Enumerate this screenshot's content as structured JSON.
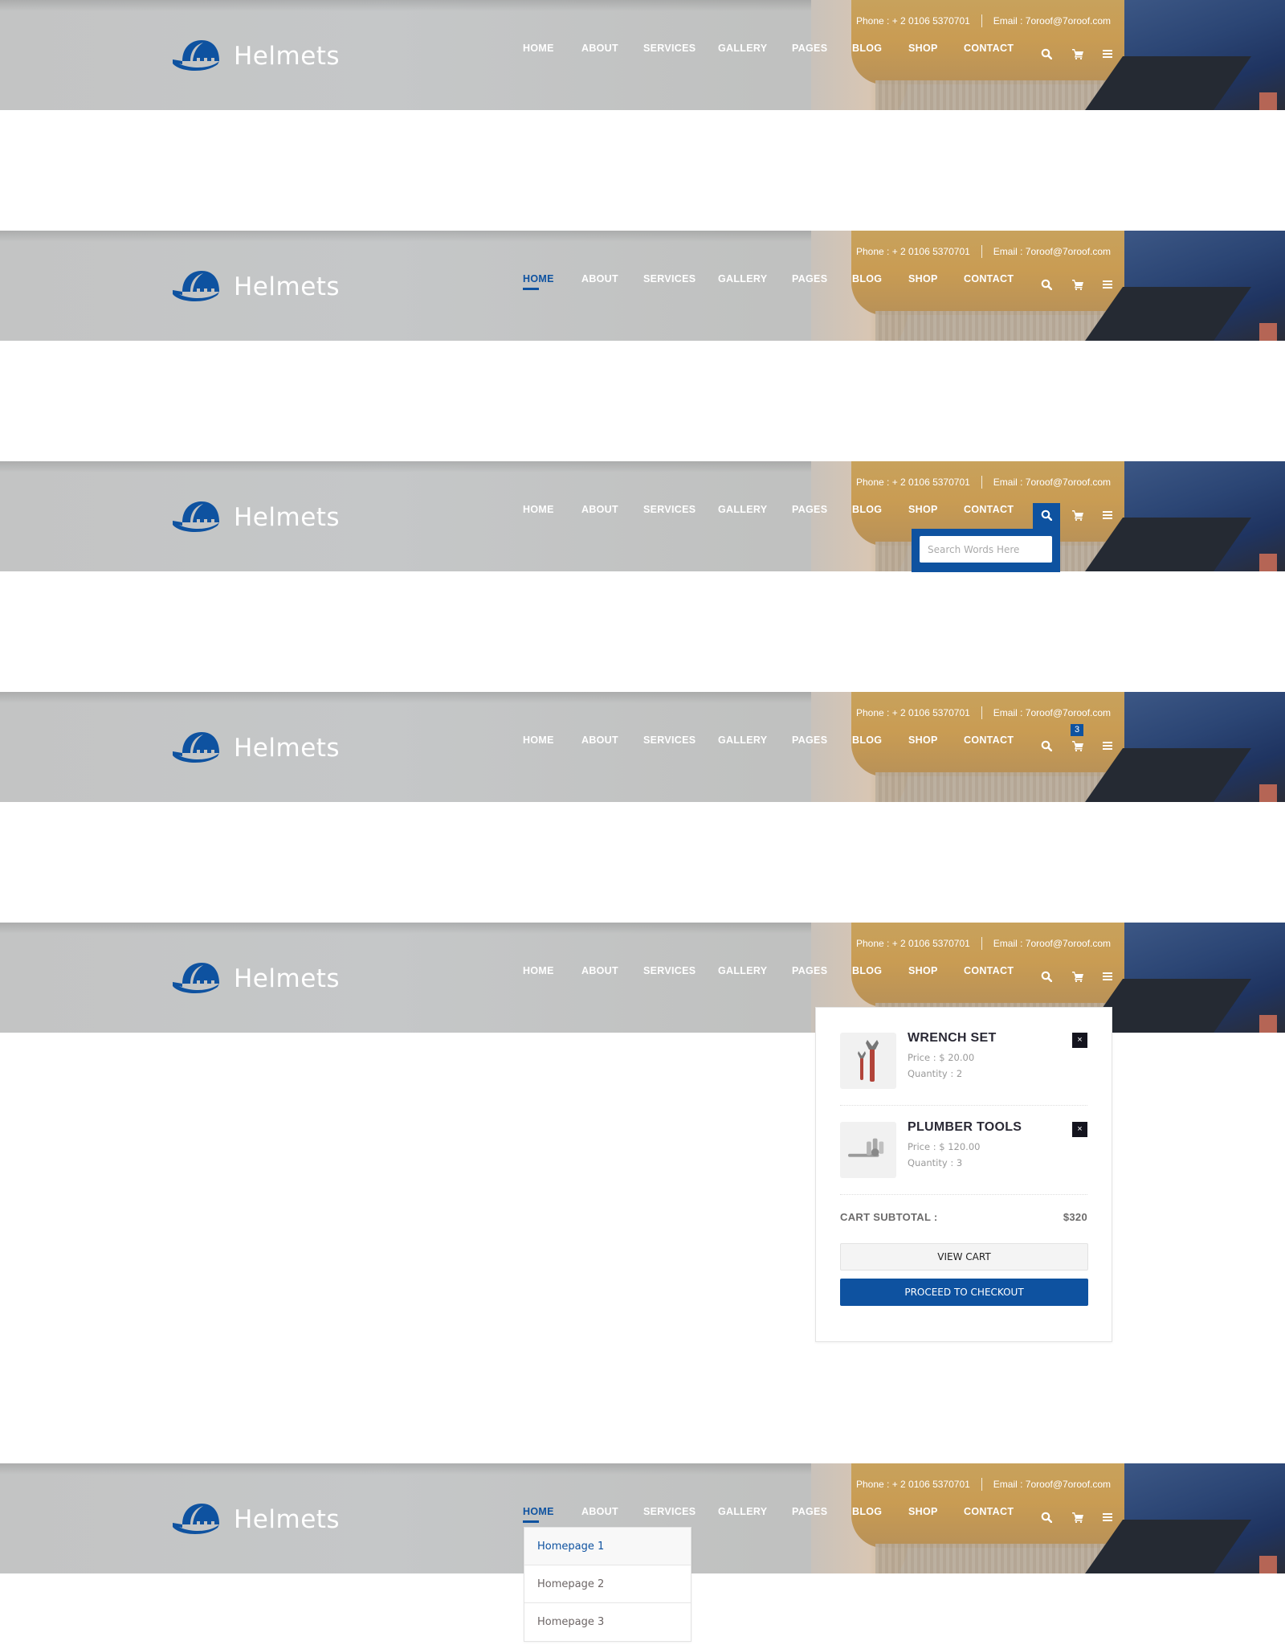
{
  "brand": {
    "name": "Helmets",
    "accent": "#0e52a0"
  },
  "contact": {
    "phone_label": "Phone : + 2 0106 5370701",
    "email_label": "Email : 7oroof@7oroof.com"
  },
  "nav": {
    "items": [
      {
        "label": "HOME"
      },
      {
        "label": "ABOUT"
      },
      {
        "label": "SERVICES"
      },
      {
        "label": "GALLERY"
      },
      {
        "label": "PAGES"
      },
      {
        "label": "BLOG"
      },
      {
        "label": "SHOP"
      },
      {
        "label": "CONTACT"
      }
    ],
    "icons": [
      "search-icon",
      "cart-icon",
      "menu-icon"
    ]
  },
  "states": [
    {
      "name": "default"
    },
    {
      "name": "home-active"
    },
    {
      "name": "search-open"
    },
    {
      "name": "cart-badge"
    },
    {
      "name": "cart-open"
    },
    {
      "name": "home-dropdown"
    }
  ],
  "search": {
    "placeholder": "Search Words Here"
  },
  "cart": {
    "count": "3",
    "items": [
      {
        "name": "WRENCH SET",
        "price": "Price : $ 20.00",
        "quantity": "Quantity : 2",
        "remove": "×"
      },
      {
        "name": "PLUMBER TOOLS",
        "price": "Price : $ 120.00",
        "quantity": "Quantity : 3",
        "remove": "×"
      }
    ],
    "subtotal_label": "CART SUBTOTAL :",
    "subtotal_value": "$320",
    "view_cart": "VIEW CART",
    "checkout": "PROCEED TO CHECKOUT"
  },
  "home_dropdown": {
    "items": [
      {
        "label": "Homepage 1"
      },
      {
        "label": "Homepage 2"
      },
      {
        "label": "Homepage 3"
      }
    ]
  }
}
